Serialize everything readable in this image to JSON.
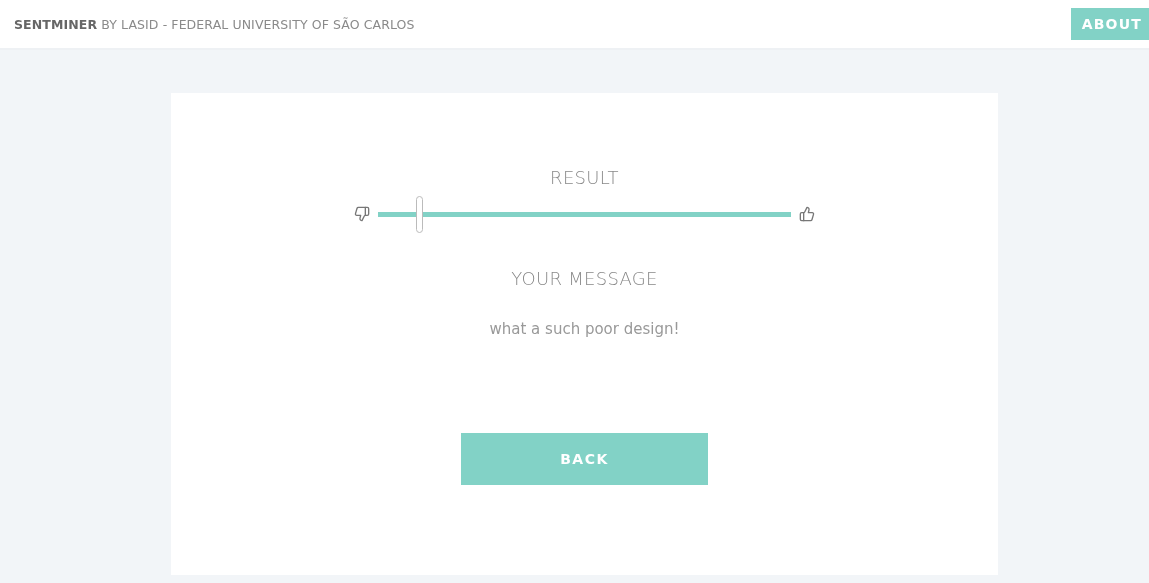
{
  "header": {
    "title": "**SENTMINER** BY LASID - FEDERAL UNIVERSITY OF SÃO CARLOS",
    "about_button": "ABOUT"
  },
  "result": {
    "heading": "RESULT",
    "level": 0.1
  },
  "message": {
    "heading": "YOUR MESSAGE",
    "text": "what a such poor design!"
  },
  "back_button": "BACK"
}
